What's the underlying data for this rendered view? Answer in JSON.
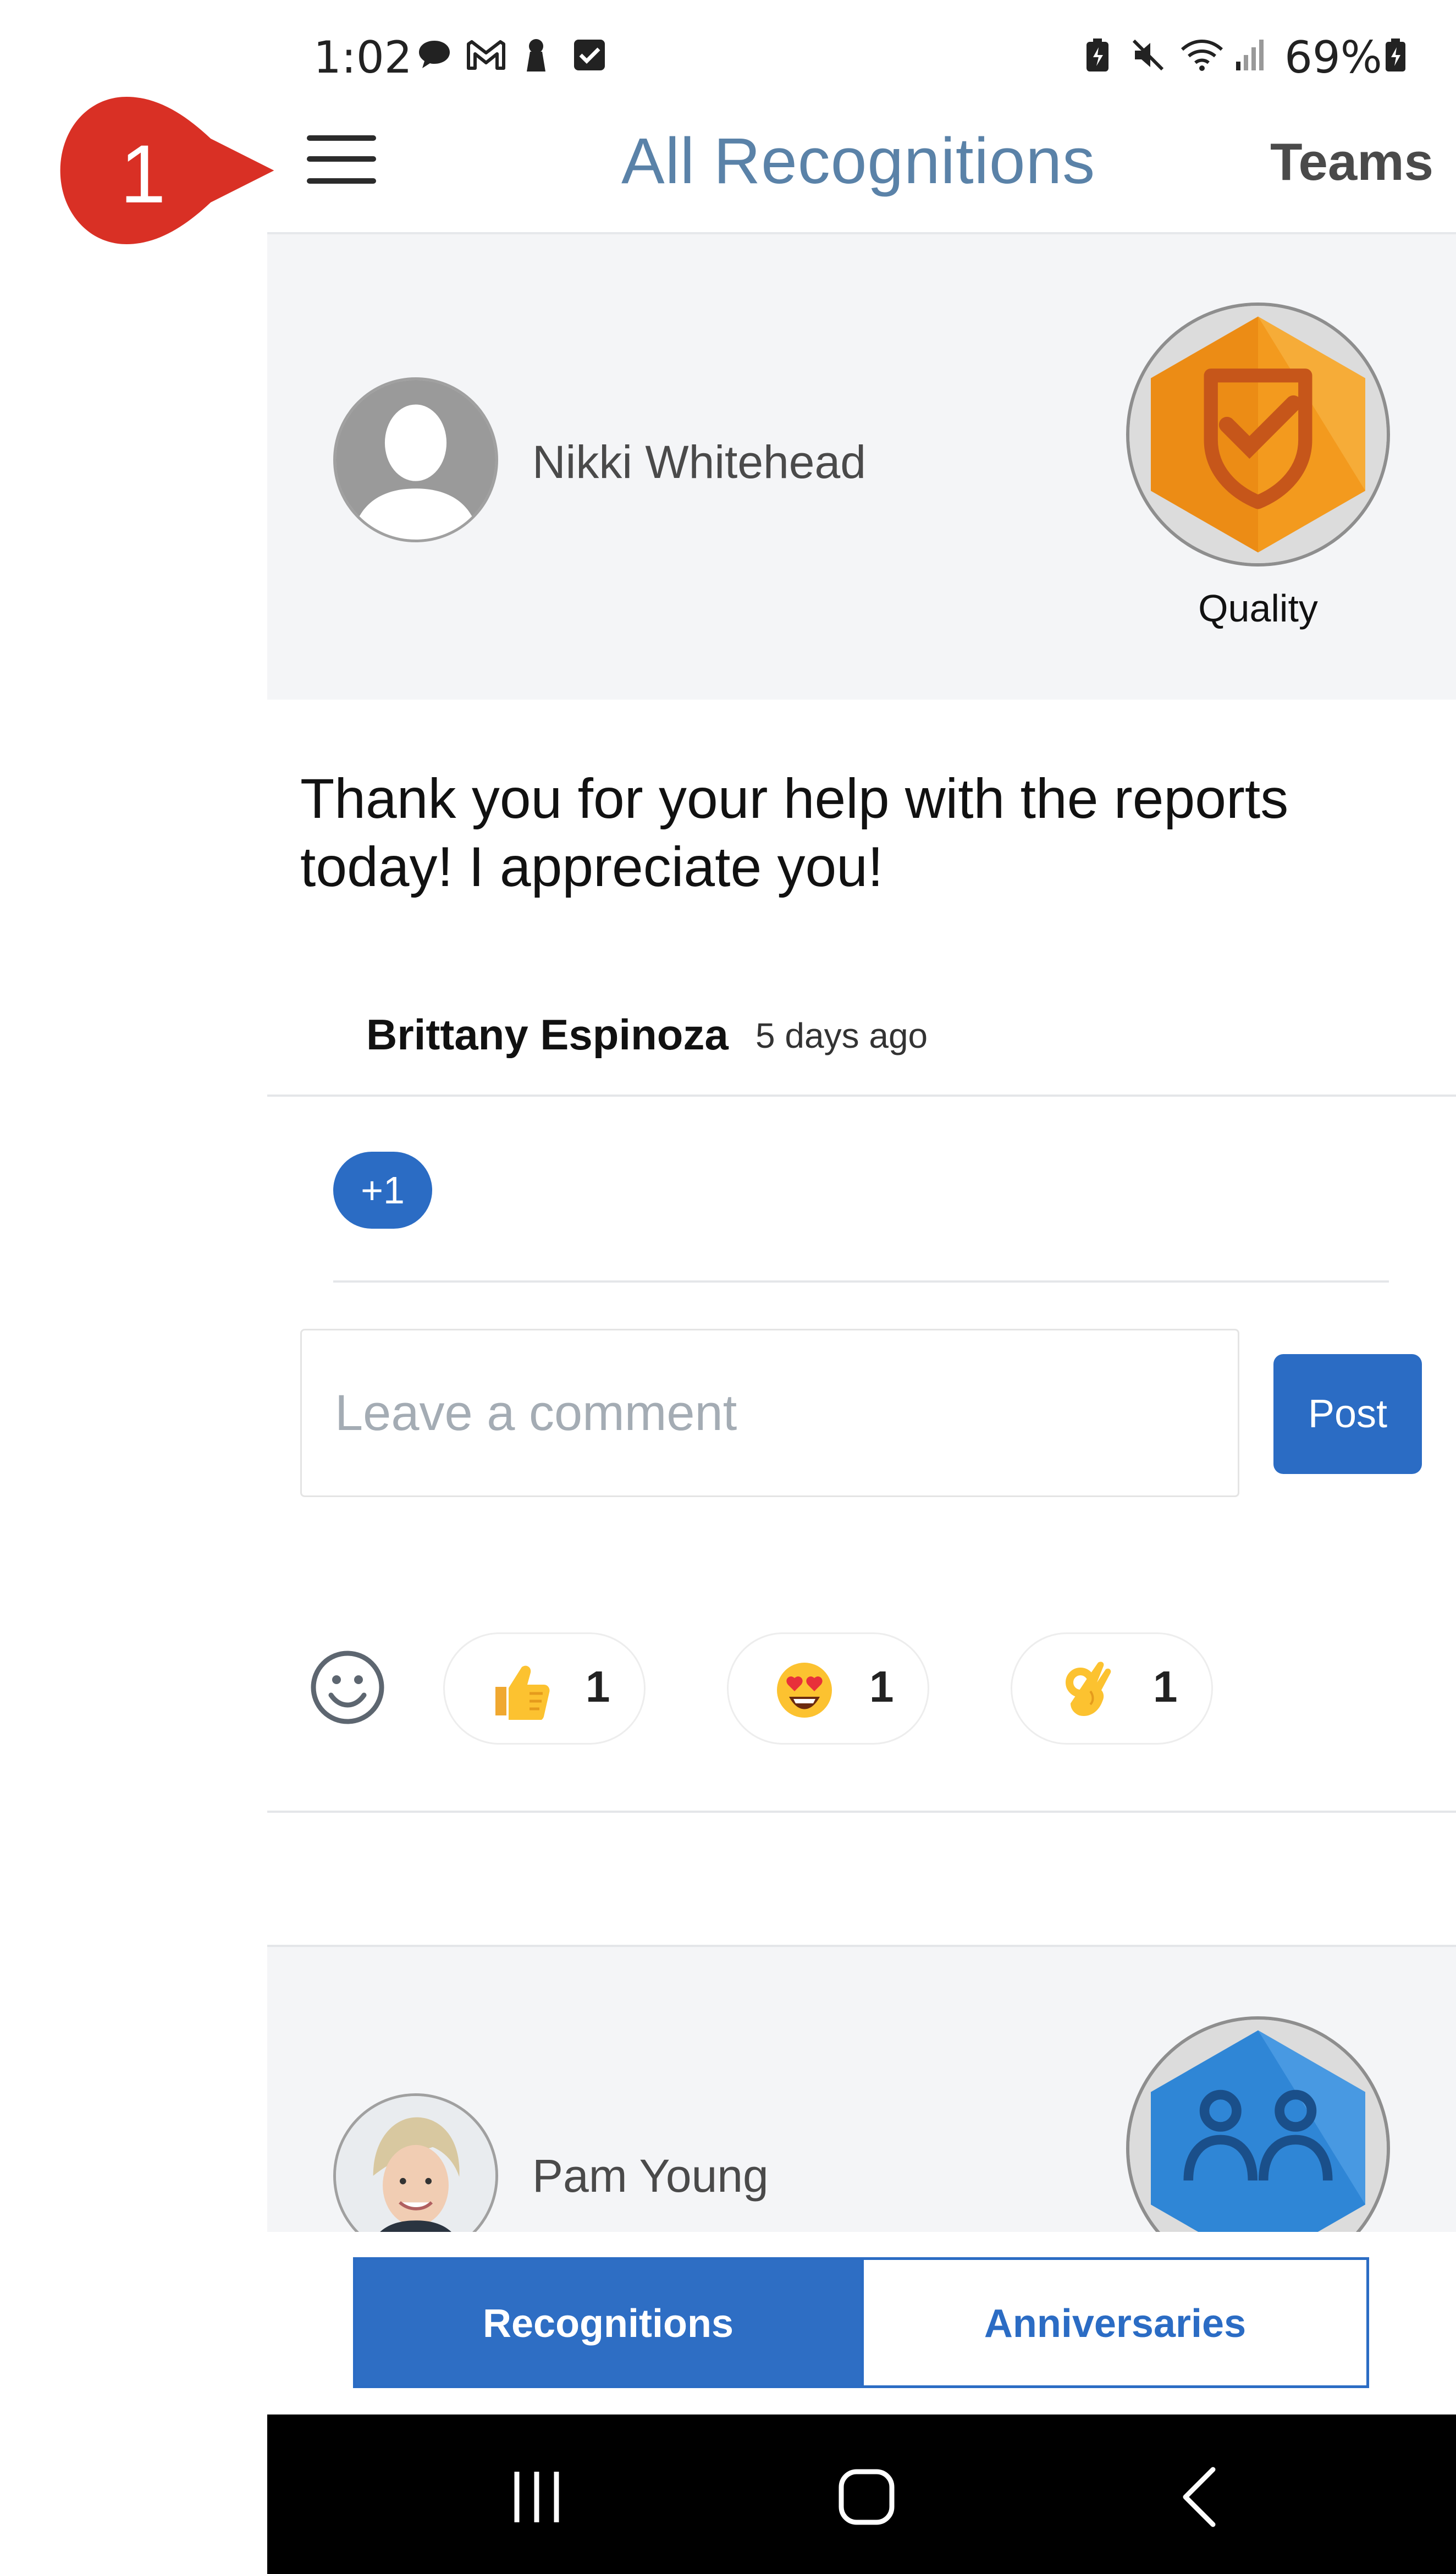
{
  "status_bar": {
    "time": "1:02",
    "battery": "69%",
    "left_icons": [
      "chat-icon",
      "gmail-icon",
      "keyhole-icon",
      "checkbox-icon"
    ],
    "right_icons": [
      "battery-saver-icon",
      "mute-icon",
      "wifi-icon",
      "signal-icon",
      "battery-icon"
    ]
  },
  "header": {
    "title": "All Recognitions",
    "teams_label": "Teams"
  },
  "callout": {
    "number": "1",
    "color": "#d93025"
  },
  "recognitions": [
    {
      "recipient": "Nikki Whitehead",
      "badge": {
        "label": "Quality",
        "icon": "shield-check-icon"
      },
      "message": "Thank you for your help with the reports today! I appreciate you!",
      "giver": "Brittany Espinoza",
      "time_ago": "5 days ago",
      "plus_label": "+1",
      "comment_placeholder": "Leave a comment",
      "post_label": "Post",
      "reactions": [
        {
          "emoji": "thumbs-up",
          "count": "1"
        },
        {
          "emoji": "heart-eyes",
          "count": "1"
        },
        {
          "emoji": "ok-hand",
          "count": "1"
        }
      ]
    },
    {
      "recipient": "Pam Young",
      "badge": {
        "label": "",
        "icon": "teamwork-icon"
      }
    }
  ],
  "tabs": {
    "recognitions": "Recognitions",
    "anniversaries": "Anniversaries",
    "active": "recognitions"
  },
  "colors": {
    "accent": "#2b6cc4",
    "title": "#5a82a8",
    "card_bg": "#f4f5f7",
    "badge_orange": "#f39a1e",
    "badge_blue": "#2f86d6"
  }
}
